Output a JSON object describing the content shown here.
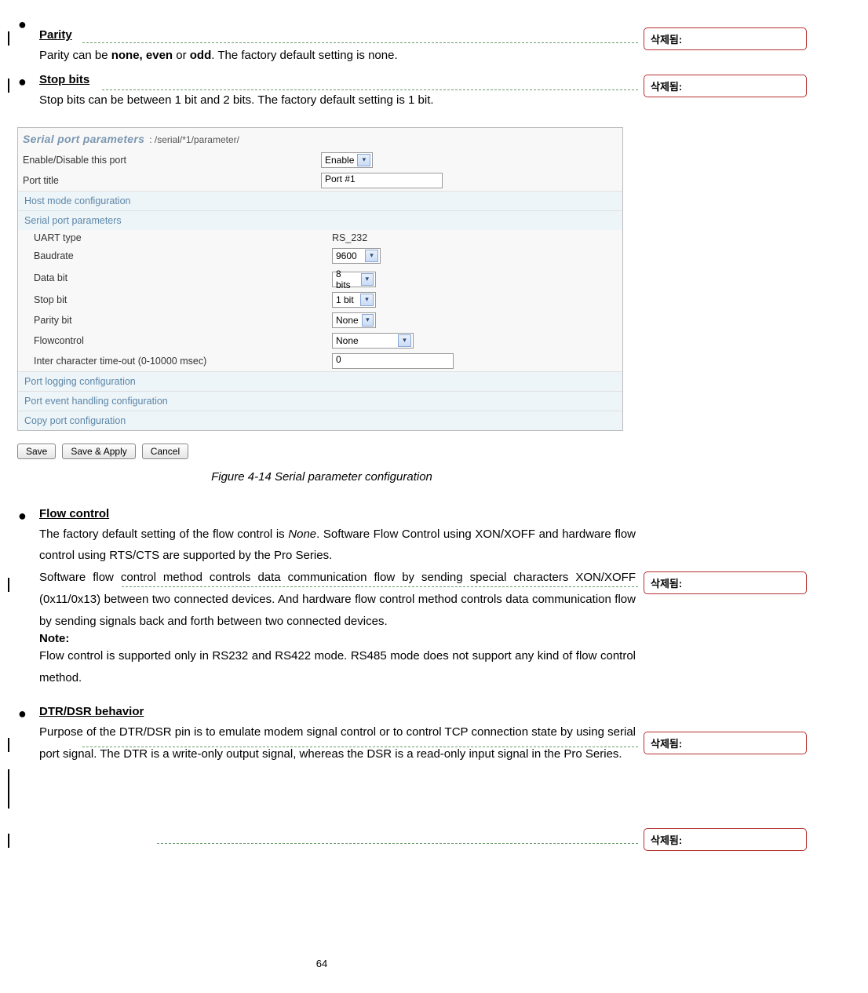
{
  "sections": {
    "parity": {
      "title": "Parity",
      "body_pre": "Parity can be ",
      "bold1": "none, even",
      "mid": " or ",
      "bold2": "odd",
      "body_post": ". The factory default setting is none."
    },
    "stopbits": {
      "title": "Stop bits",
      "body": "Stop bits can be between 1 bit and 2 bits. The factory default setting is 1 bit."
    },
    "flowcontrol": {
      "title": "Flow control",
      "p1_pre": "The factory default setting of the flow control is ",
      "p1_italic": "None",
      "p1_post": ". Software Flow Control using XON/XOFF and hardware flow control using RTS/CTS are supported by the Pro Series.",
      "p2": "Software flow control method controls data communication flow by sending special characters XON/XOFF (0x11/0x13) between two connected devices. And hardware flow control method controls data communication flow by sending signals back and forth between two connected devices.",
      "note_title": "Note:",
      "note_body": "Flow control is supported only in RS232 and RS422 mode. RS485 mode does not support any kind of flow control method."
    },
    "dtr": {
      "title": "DTR/DSR behavior",
      "body": "Purpose of the DTR/DSR pin is to emulate modem signal control or to control TCP connection state by using serial port signal. The DTR is a write-only output signal, whereas the DSR is a read-only input signal in the Pro Series."
    }
  },
  "figure": {
    "title": "Serial port parameters",
    "path": ": /serial/*1/parameter/",
    "rows": {
      "enable_label": "Enable/Disable this port",
      "enable_value": "Enable",
      "porttitle_label": "Port title",
      "porttitle_value": "Port #1",
      "hostmode": "Host mode configuration",
      "serialparams": "Serial port parameters",
      "uart_label": "UART type",
      "uart_value": "RS_232",
      "baud_label": "Baudrate",
      "baud_value": "9600",
      "databit_label": "Data bit",
      "databit_value": "8 bits",
      "stopbit_label": "Stop bit",
      "stopbit_value": "1 bit",
      "parity_label": "Parity bit",
      "parity_value": "None",
      "flow_label": "Flowcontrol",
      "flow_value": "None",
      "ict_label": "Inter character time-out (0-10000 msec)",
      "ict_value": "0",
      "portlog": "Port logging configuration",
      "portevent": "Port event handling configuration",
      "copyport": "Copy port configuration"
    },
    "buttons": {
      "save": "Save",
      "saveapply": "Save & Apply",
      "cancel": "Cancel"
    },
    "caption": "Figure 4-14 Serial parameter configuration"
  },
  "comments": {
    "c1": "삭제됨: ",
    "c2": "삭제됨: ",
    "c3": "삭제됨: ",
    "c4": "삭제됨: ",
    "c5": "삭제됨: "
  },
  "page_number": "64"
}
